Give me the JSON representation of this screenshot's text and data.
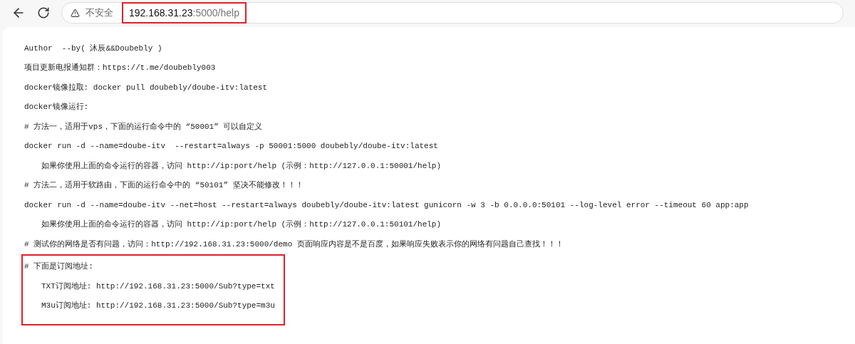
{
  "browser": {
    "security_label": "不安全",
    "url_host": "192.168.31.23",
    "url_path": ":5000/help",
    "url_highlighted": true
  },
  "lines": [
    {
      "kind": "plain",
      "text": "Author  --by( 沐辰&&Doubebly )"
    },
    {
      "kind": "plain",
      "text": "项目更新电报通知群：https://t.me/doubebly003"
    },
    {
      "kind": "plain",
      "text": "docker镜像拉取: docker pull doubebly/doube-itv:latest"
    },
    {
      "kind": "plain",
      "text": "docker镜像运行:"
    },
    {
      "kind": "plain",
      "text": "# 方法一，适用于vps，下面的运行命令中的 “50001” 可以自定义"
    },
    {
      "kind": "plain",
      "text": "docker run -d --name=doube-itv  --restart=always -p 50001:5000 doubebly/doube-itv:latest"
    },
    {
      "kind": "indented",
      "text": "如果你使用上面的命令运行的容器，访问 http://ip:port/help (示例：http://127.0.0.1:50001/help)"
    },
    {
      "kind": "plain",
      "text": "# 方法二，适用于软路由，下面的运行命令中的 “50101” 坚决不能修改！！！"
    },
    {
      "kind": "plain",
      "text": "docker run -d --name=doube-itv --net=host --restart=always doubebly/doube-itv:latest gunicorn -w 3 -b 0.0.0.0:50101 --log-level error --timeout 60 app:app"
    },
    {
      "kind": "indented",
      "text": "如果你使用上面的命令运行的容器，访问 http://ip:port/help (示例：http://127.0.0.1:50101/help)"
    },
    {
      "kind": "plain",
      "text": "# 测试你的网络是否有问题，访问：http://192.168.31.23:5000/demo 页面响应内容是不是百度，如果响应失败表示你的网络有问题自己查找！！！"
    }
  ],
  "subscription_block": {
    "highlighted": true,
    "lines": [
      {
        "kind": "plain",
        "text": "# 下面是订阅地址:"
      },
      {
        "kind": "indented",
        "text": "TXT订阅地址: http://192.168.31.23:5000/Sub?type=txt"
      },
      {
        "kind": "indented",
        "text": "M3u订阅地址: http://192.168.31.23:5000/Sub?type=m3u"
      }
    ]
  }
}
